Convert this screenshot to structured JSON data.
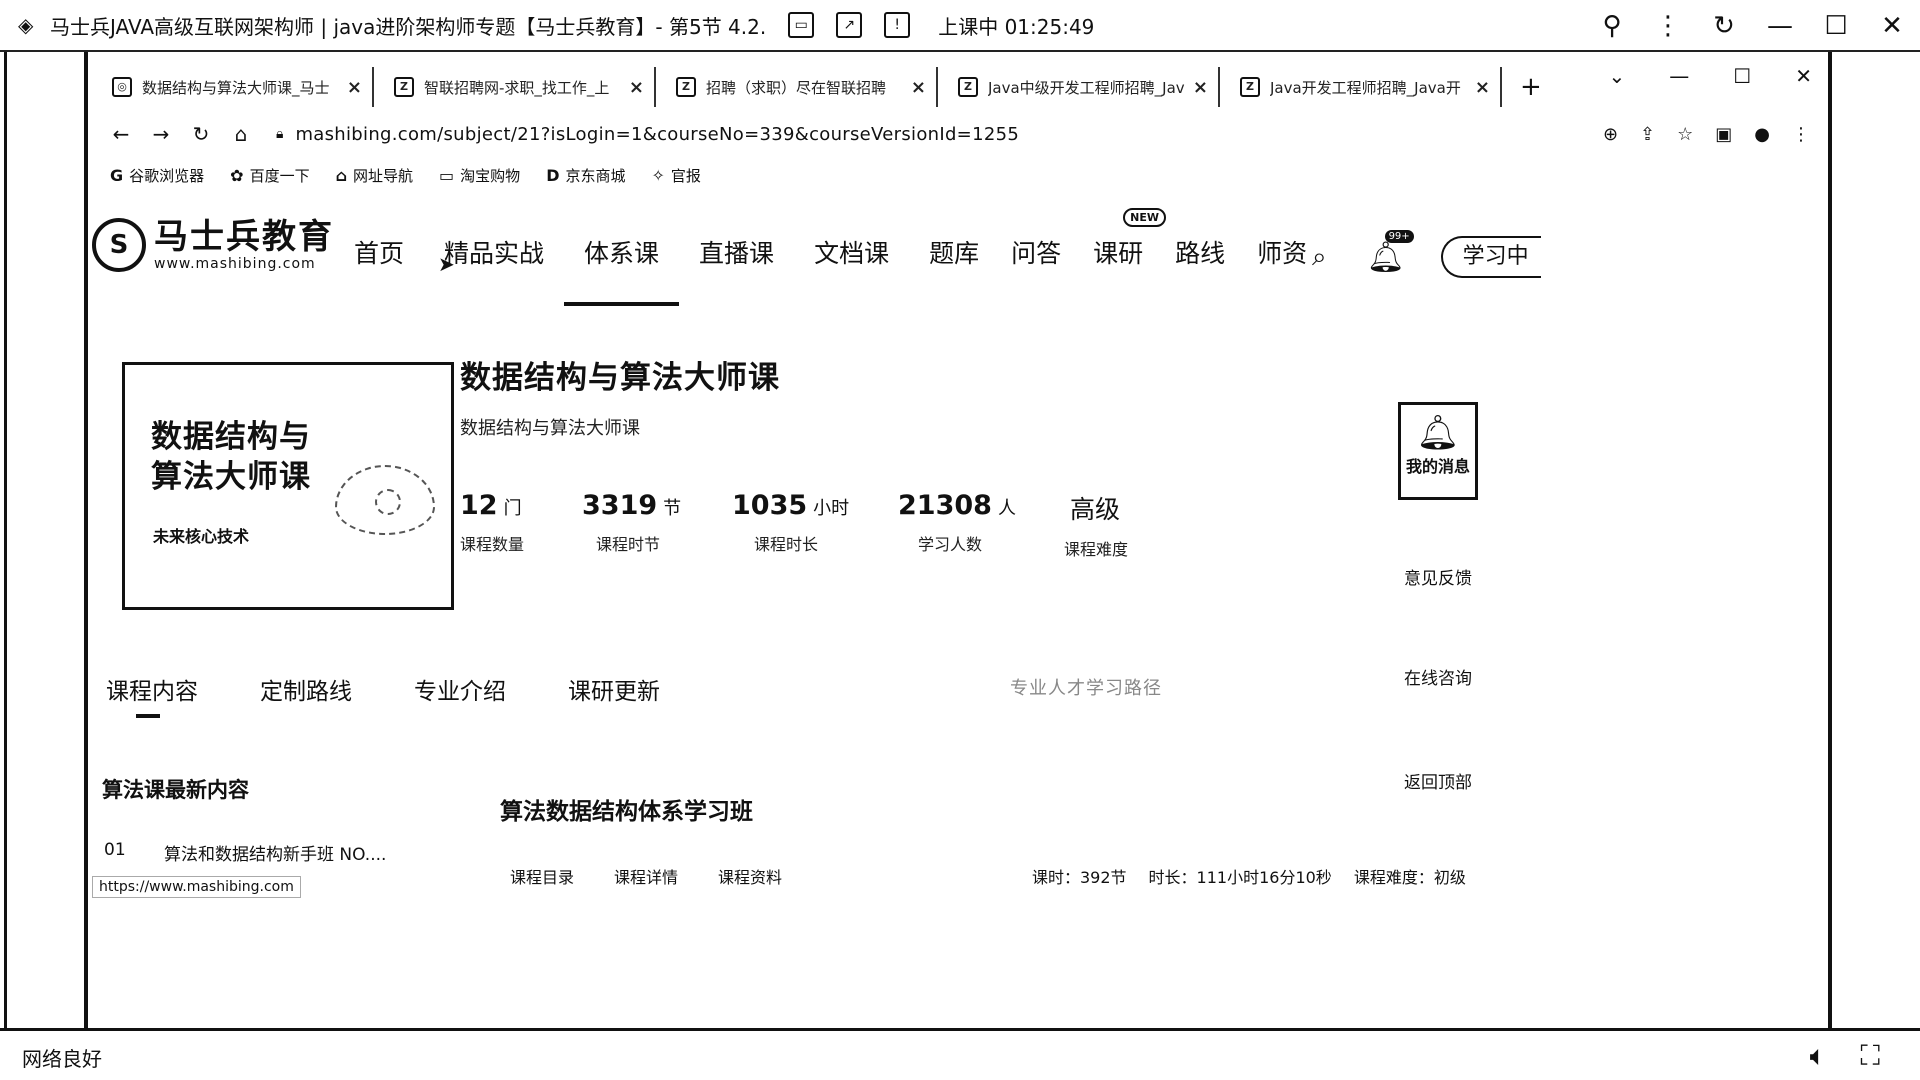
{
  "player": {
    "title": "马士兵JAVA高级互联网架构师 | java进阶架构师专题【马士兵教育】- 第5节 4.2.",
    "live_status": "上课中 01:25:49",
    "network": "网络良好"
  },
  "browser": {
    "tabs": [
      {
        "label": "数据结构与算法大师课_马士",
        "icon": "globe-icon"
      },
      {
        "label": "智联招聘网-求职_找工作_上",
        "icon": "zhilian-icon"
      },
      {
        "label": "招聘（求职）尽在智联招聘",
        "icon": "zhilian-icon"
      },
      {
        "label": "Java中级开发工程师招聘_Jav",
        "icon": "zhilian-icon"
      },
      {
        "label": "Java开发工程师招聘_Java开",
        "icon": "zhilian-icon"
      }
    ],
    "url": "mashibing.com/subject/21?isLogin=1&courseNo=339&courseVersionId=1255",
    "bookmarks": [
      "谷歌浏览器",
      "百度一下",
      "网址导航",
      "淘宝购物",
      "京东商城",
      "官报"
    ],
    "status_url": "https://www.mashibing.com"
  },
  "site": {
    "brand_cn": "马士兵教育",
    "brand_en": "www.mashibing.com",
    "menu": [
      "首页",
      "精品实战",
      "体系课",
      "直播课",
      "文档课",
      "题库",
      "问答",
      "课研",
      "路线",
      "师资"
    ],
    "new_badge": "NEW",
    "bell_count": "99+",
    "study_button": "学习中"
  },
  "course": {
    "cover_line1": "数据结构与",
    "cover_line2": "算法大师课",
    "cover_tag": "未来核心技术",
    "title": "数据结构与算法大师课",
    "subtitle": "数据结构与算法大师课",
    "stats": [
      {
        "value": "12",
        "unit": "门",
        "label": "课程数量"
      },
      {
        "value": "3319",
        "unit": "节",
        "label": "课程时节"
      },
      {
        "value": "1035",
        "unit": "小时",
        "label": "课程时长"
      },
      {
        "value": "21308",
        "unit": "人",
        "label": "学习人数"
      },
      {
        "value": "高级",
        "unit": "",
        "label": "课程难度"
      }
    ]
  },
  "float_panel": {
    "messages": "我的消息",
    "feedback": "意见反馈",
    "consult": "在线咨询",
    "back_top": "返回顶部"
  },
  "content_tabs": [
    "课程内容",
    "定制路线",
    "专业介绍",
    "课研更新"
  ],
  "blurred_text": "专业人才学习路径",
  "latest": {
    "heading": "算法课最新内容",
    "item_no": "01",
    "item_text": "算法和数据结构新手班 NO...."
  },
  "class": {
    "title": "算法数据结构体系学习班",
    "links": [
      "课程目录",
      "课程详情",
      "课程资料"
    ],
    "meta": [
      "课时：392节",
      "时长：111小时16分10秒",
      "课程难度：初级"
    ]
  }
}
